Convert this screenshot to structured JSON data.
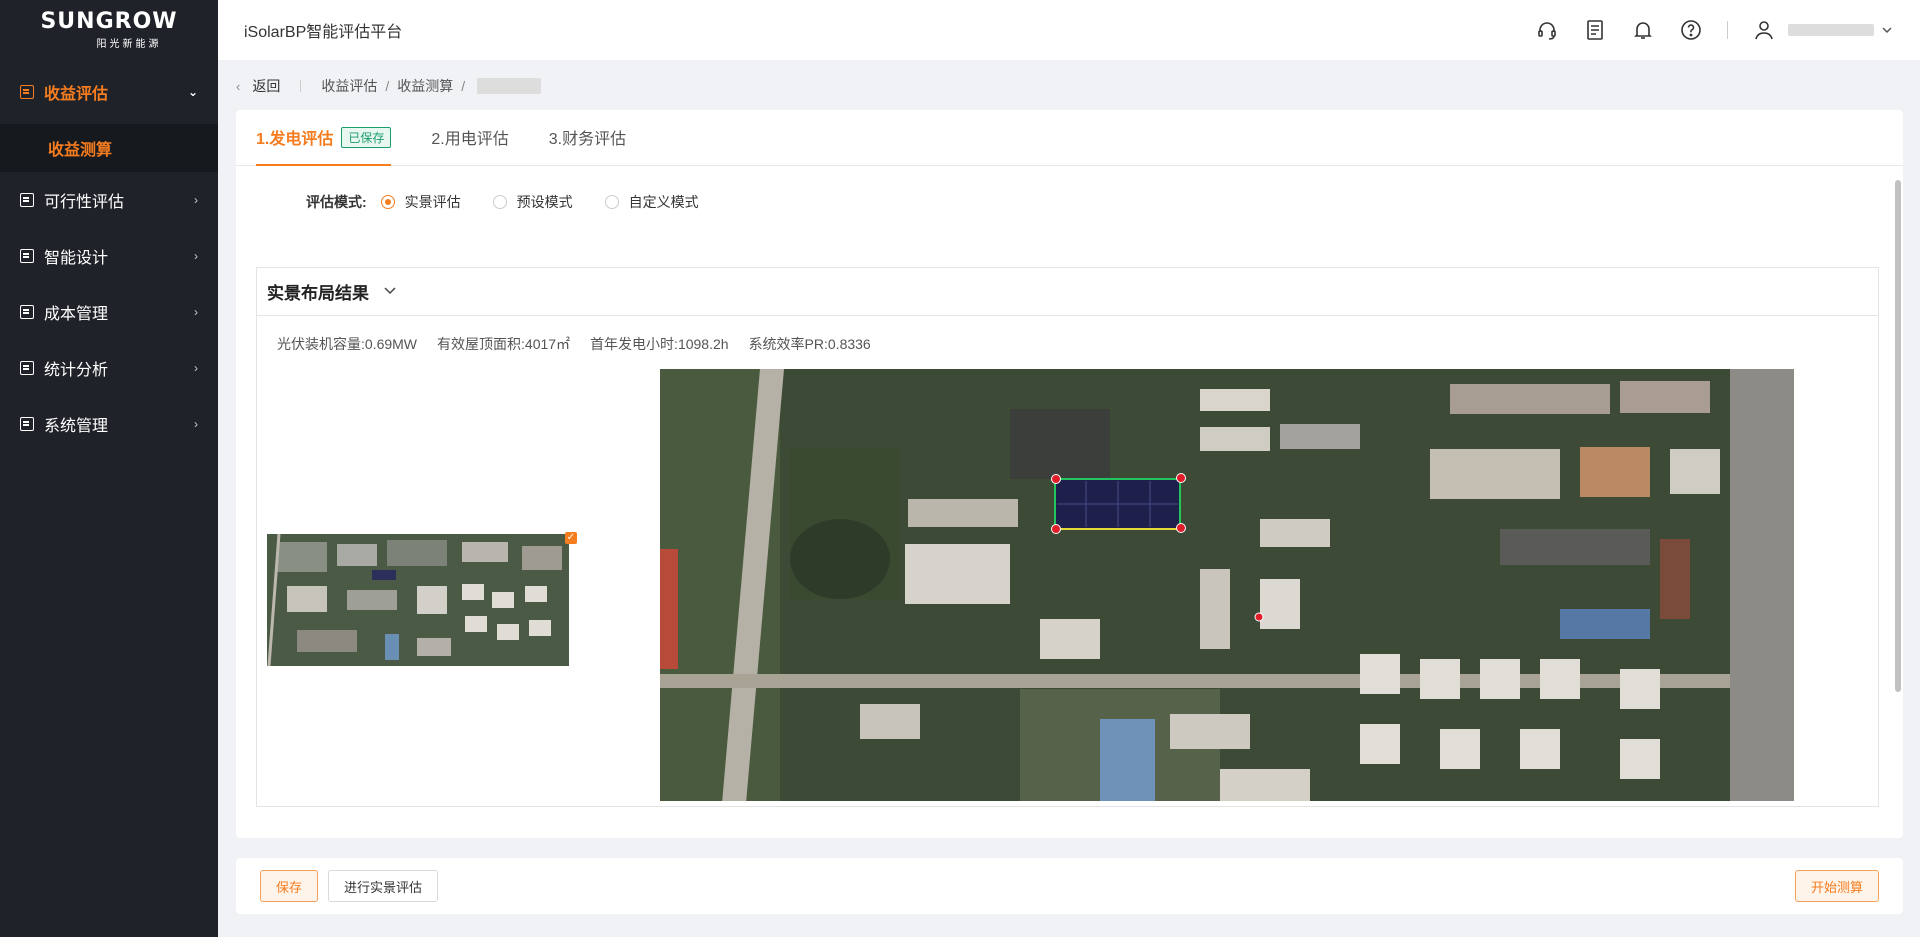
{
  "brand": {
    "name": "SUNGROW",
    "subtitle": "阳光新能源"
  },
  "app": {
    "title": "iSolarBP智能评估平台"
  },
  "sidebar": {
    "items": [
      {
        "label": "收益评估",
        "icon": "revenue-icon",
        "expanded": true,
        "children": [
          {
            "label": "收益测算"
          }
        ]
      },
      {
        "label": "可行性评估",
        "icon": "feasibility-icon"
      },
      {
        "label": "智能设计",
        "icon": "design-icon"
      },
      {
        "label": "成本管理",
        "icon": "cost-icon"
      },
      {
        "label": "统计分析",
        "icon": "statistics-icon"
      },
      {
        "label": "系统管理",
        "icon": "system-icon"
      }
    ]
  },
  "header": {
    "icons": [
      "headset-icon",
      "document-icon",
      "bell-icon",
      "help-icon",
      "user-icon"
    ]
  },
  "breadcrumb": {
    "back": "返回",
    "items": [
      "收益评估",
      "收益测算"
    ]
  },
  "tabs": [
    {
      "label": "1.发电评估",
      "badge": "已保存",
      "active": true
    },
    {
      "label": "2.用电评估"
    },
    {
      "label": "3.财务评估"
    }
  ],
  "mode": {
    "label": "评估模式:",
    "options": [
      "实景评估",
      "预设模式",
      "自定义模式"
    ],
    "selected": "实景评估"
  },
  "panel": {
    "title": "实景布局结果",
    "stats": {
      "capacity": "光伏装机容量:0.69MW",
      "roof_area": "有效屋顶面积:4017㎡",
      "first_year_hours": "首年发电小时:1098.2h",
      "system_pr": "系统效率PR:0.8336"
    }
  },
  "actions": {
    "save": "保存",
    "real_eval": "进行实景评估",
    "start_calc": "开始测算"
  },
  "colors": {
    "accent": "#f57c1f",
    "sidebar_bg": "#1f2329",
    "saved_green": "#1a9e6a"
  }
}
